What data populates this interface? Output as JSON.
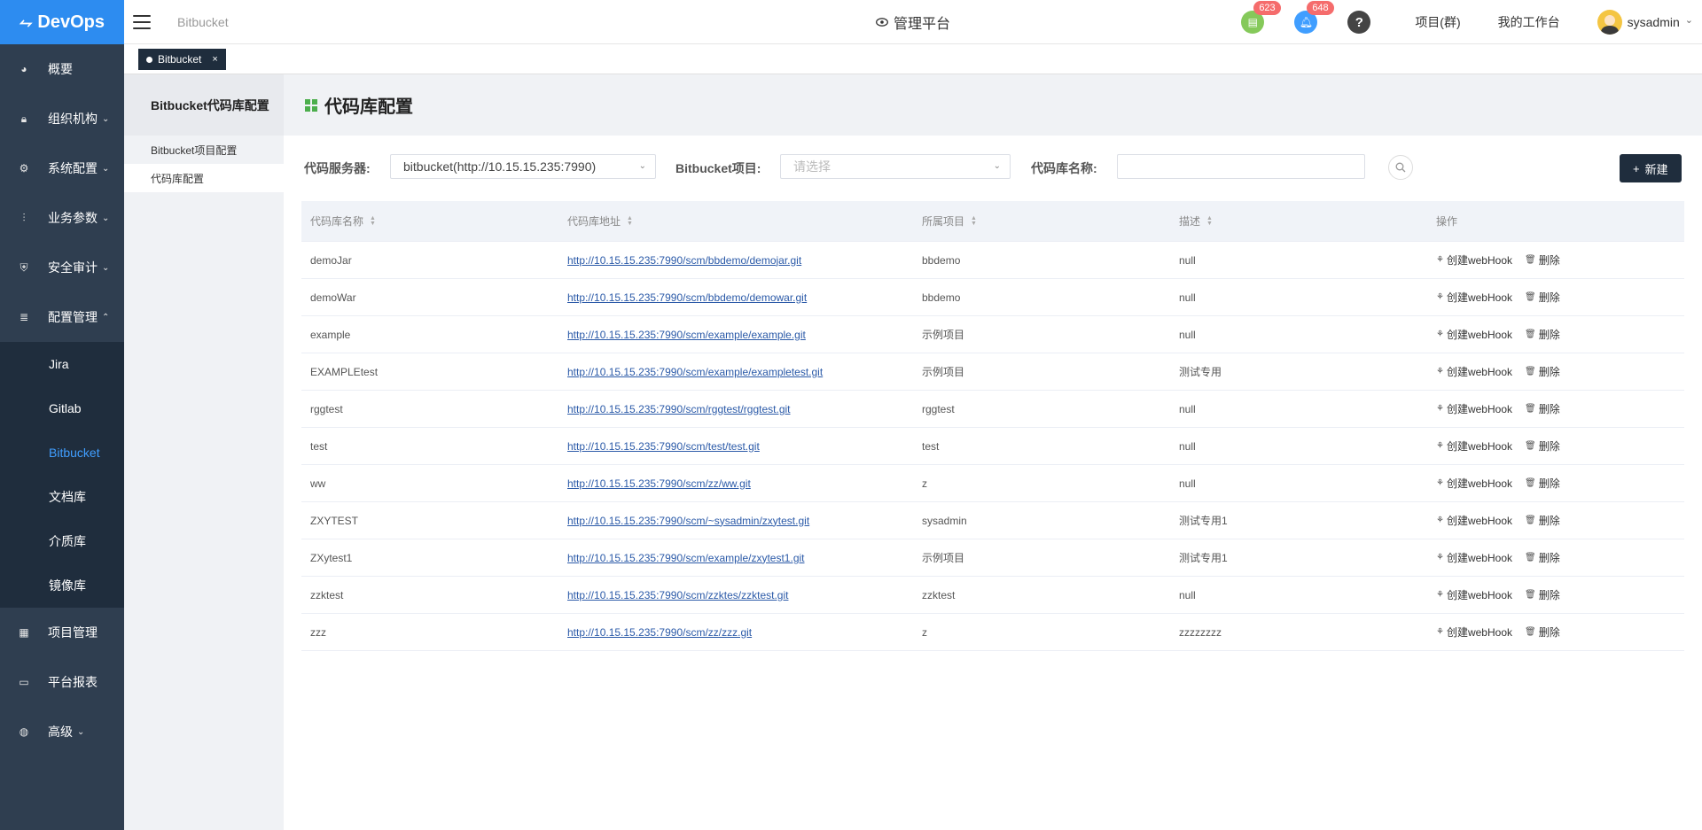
{
  "app": {
    "logo_mark": "⥊",
    "logo_text": "DevOps"
  },
  "sidebar": {
    "items": [
      {
        "label": "概要",
        "icon": "dashboard-icon"
      },
      {
        "label": "组织机构",
        "icon": "lock-icon",
        "chevron": "⌄"
      },
      {
        "label": "系统配置",
        "icon": "gear-icon",
        "chevron": "⌄"
      },
      {
        "label": "业务参数",
        "icon": "sliders-icon",
        "chevron": "⌄"
      },
      {
        "label": "安全审计",
        "icon": "shield-icon",
        "chevron": "⌄"
      },
      {
        "label": "配置管理",
        "icon": "database-icon",
        "chevron": "⌃"
      }
    ],
    "sub_items": [
      "Jira",
      "Gitlab",
      "Bitbucket",
      "文档库",
      "介质库",
      "镜像库"
    ],
    "active_sub": "Bitbucket",
    "bottom_items": [
      {
        "label": "项目管理",
        "icon": "grid-icon"
      },
      {
        "label": "平台报表",
        "icon": "monitor-icon"
      },
      {
        "label": "高级",
        "icon": "palette-icon",
        "chevron": "⌄"
      }
    ]
  },
  "header": {
    "crumb": "Bitbucket",
    "center_title": "管理平台",
    "badge_tasks": "623",
    "badge_notices": "648",
    "help": "?",
    "project_link": "项目(群)",
    "workspace_link": "我的工作台",
    "username": "sysadmin",
    "user_chevron": "⌄"
  },
  "tab": {
    "label": "Bitbucket",
    "close": "×"
  },
  "subnav": {
    "title": "Bitbucket代码库配置",
    "items": [
      "Bitbucket项目配置",
      "代码库配置"
    ]
  },
  "page": {
    "title": "代码库配置"
  },
  "filters": {
    "server_label": "代码服务器:",
    "server_value": "bitbucket(http://10.15.15.235:7990)",
    "project_label": "Bitbucket项目:",
    "project_placeholder": "请选择",
    "repo_label": "代码库名称:",
    "repo_value": "",
    "new_button": "新建"
  },
  "table": {
    "headers": [
      "代码库名称",
      "代码库地址",
      "所属项目",
      "描述",
      "操作"
    ],
    "action_webhook": "创建webHook",
    "action_delete": "删除",
    "rows": [
      {
        "name": "demoJar",
        "url": "http://10.15.15.235:7990/scm/bbdemo/demojar.git",
        "project": "bbdemo",
        "desc": "null"
      },
      {
        "name": "demoWar",
        "url": "http://10.15.15.235:7990/scm/bbdemo/demowar.git",
        "project": "bbdemo",
        "desc": "null"
      },
      {
        "name": "example",
        "url": "http://10.15.15.235:7990/scm/example/example.git",
        "project": "示例项目",
        "desc": "null"
      },
      {
        "name": "EXAMPLEtest",
        "url": "http://10.15.15.235:7990/scm/example/exampletest.git",
        "project": "示例项目",
        "desc": "测试专用"
      },
      {
        "name": "rggtest",
        "url": "http://10.15.15.235:7990/scm/rggtest/rggtest.git",
        "project": "rggtest",
        "desc": "null"
      },
      {
        "name": "test",
        "url": "http://10.15.15.235:7990/scm/test/test.git",
        "project": "test",
        "desc": "null"
      },
      {
        "name": "ww",
        "url": "http://10.15.15.235:7990/scm/zz/ww.git",
        "project": "z",
        "desc": "null"
      },
      {
        "name": "ZXYTEST",
        "url": "http://10.15.15.235:7990/scm/~sysadmin/zxytest.git",
        "project": "sysadmin",
        "desc": "测试专用1"
      },
      {
        "name": "ZXytest1",
        "url": "http://10.15.15.235:7990/scm/example/zxytest1.git",
        "project": "示例项目",
        "desc": "测试专用1"
      },
      {
        "name": "zzktest",
        "url": "http://10.15.15.235:7990/scm/zzktes/zzktest.git",
        "project": "zzktest",
        "desc": "null"
      },
      {
        "name": "zzz",
        "url": "http://10.15.15.235:7990/scm/zz/zzz.git",
        "project": "z",
        "desc": "zzzzzzzz"
      }
    ]
  },
  "colors": {
    "sidebar_bg": "#2f3e50",
    "logo_bg": "#2d8cf0",
    "active": "#409eff",
    "primary_button": "#1f2d3d"
  }
}
